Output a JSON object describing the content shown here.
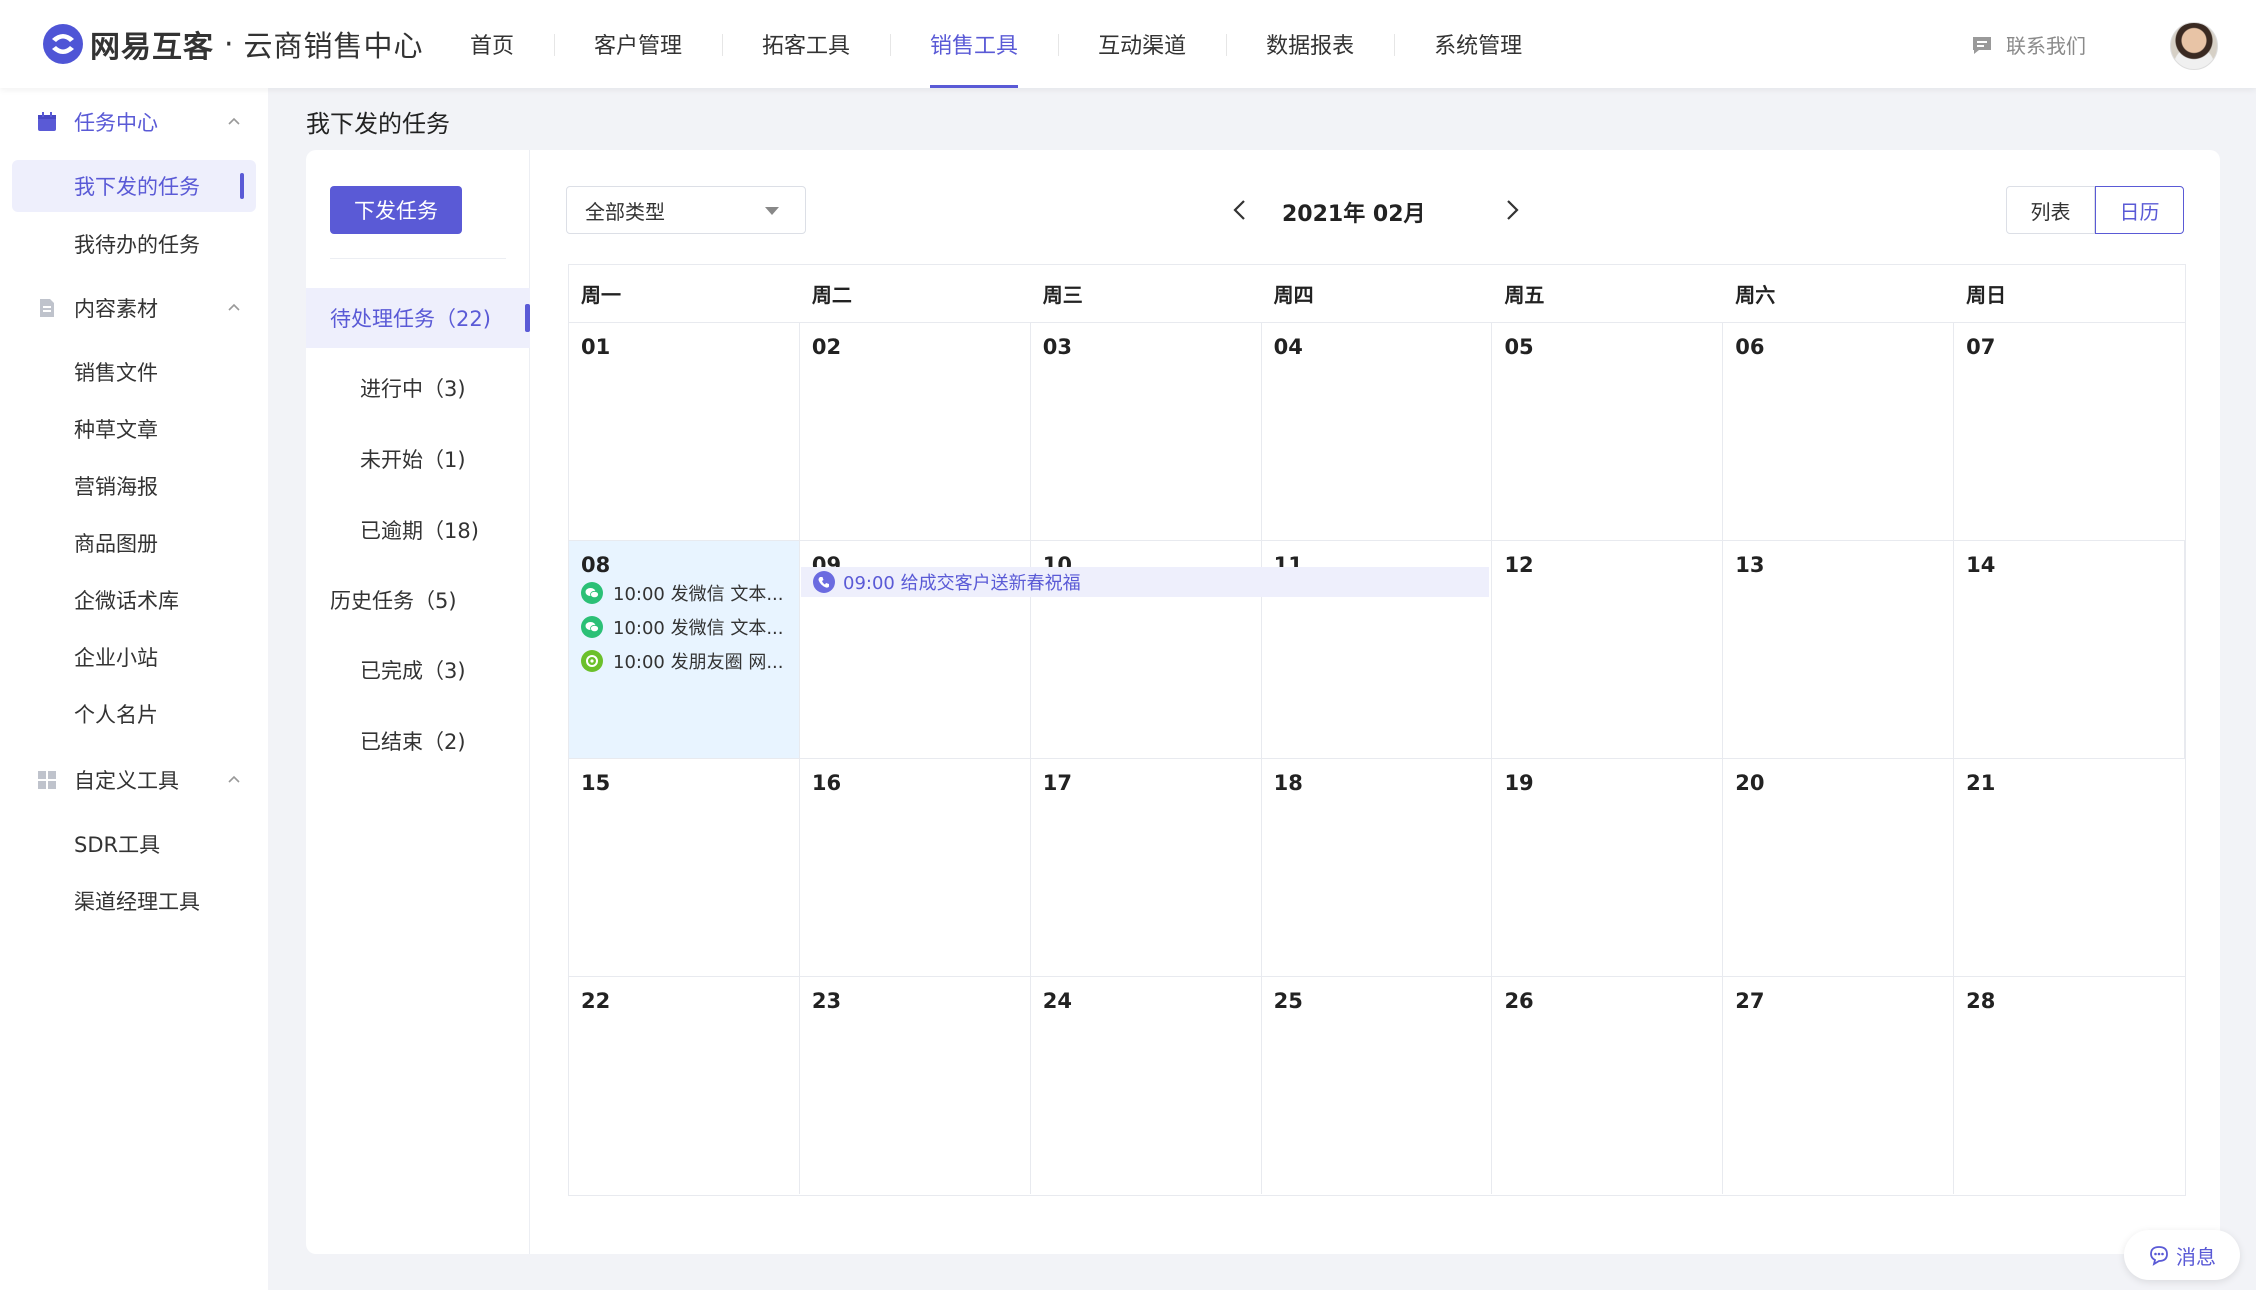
{
  "header": {
    "brand": "网易互客",
    "separator": "·",
    "subtitle": "云商销售中心",
    "nav": [
      "首页",
      "客户管理",
      "拓客工具",
      "销售工具",
      "互动渠道",
      "数据报表",
      "系统管理"
    ],
    "active_nav": "销售工具",
    "contact": "联系我们"
  },
  "sidebar": {
    "groups": [
      {
        "label": "任务中心",
        "items": [
          "我下发的任务",
          "我待办的任务"
        ]
      },
      {
        "label": "内容素材",
        "items": [
          "销售文件",
          "种草文章",
          "营销海报",
          "商品图册",
          "企微话术库",
          "企业小站",
          "个人名片"
        ]
      },
      {
        "label": "自定义工具",
        "items": [
          "SDR工具",
          "渠道经理工具"
        ]
      }
    ],
    "active_item": "我下发的任务"
  },
  "page": {
    "title": "我下发的任务",
    "issue_button": "下发任务",
    "tasks": {
      "pending": "待处理任务（22)",
      "in_progress": "进行中（3)",
      "not_started": "未开始（1)",
      "overdue": "已逾期（18)",
      "history": "历史任务（5)",
      "completed": "已完成（3)",
      "ended": "已结束（2)"
    },
    "type_select": "全部类型",
    "month": "2021年 02月",
    "view_list": "列表",
    "view_calendar": "日历"
  },
  "calendar": {
    "weekdays": [
      "周一",
      "周二",
      "周三",
      "周四",
      "周五",
      "周六",
      "周日"
    ],
    "weeks": [
      [
        "01",
        "02",
        "03",
        "04",
        "05",
        "06",
        "07"
      ],
      [
        "08",
        "09",
        "10",
        "11",
        "12",
        "13",
        "14"
      ],
      [
        "15",
        "16",
        "17",
        "18",
        "19",
        "20",
        "21"
      ],
      [
        "22",
        "23",
        "24",
        "25",
        "26",
        "27",
        "28"
      ]
    ],
    "events_08": [
      "10:00 发微信 文本...",
      "10:00 发微信 文本...",
      "10:00 发朋友圈 网..."
    ],
    "span_event": "09:00 给成交客户送新春祝福"
  },
  "colors": {
    "accent": "#5a5ad6",
    "wechat": "#2bc076",
    "moments": "#6bc02b",
    "highlight": "#e8f4ff"
  },
  "float": {
    "message": "消息"
  }
}
